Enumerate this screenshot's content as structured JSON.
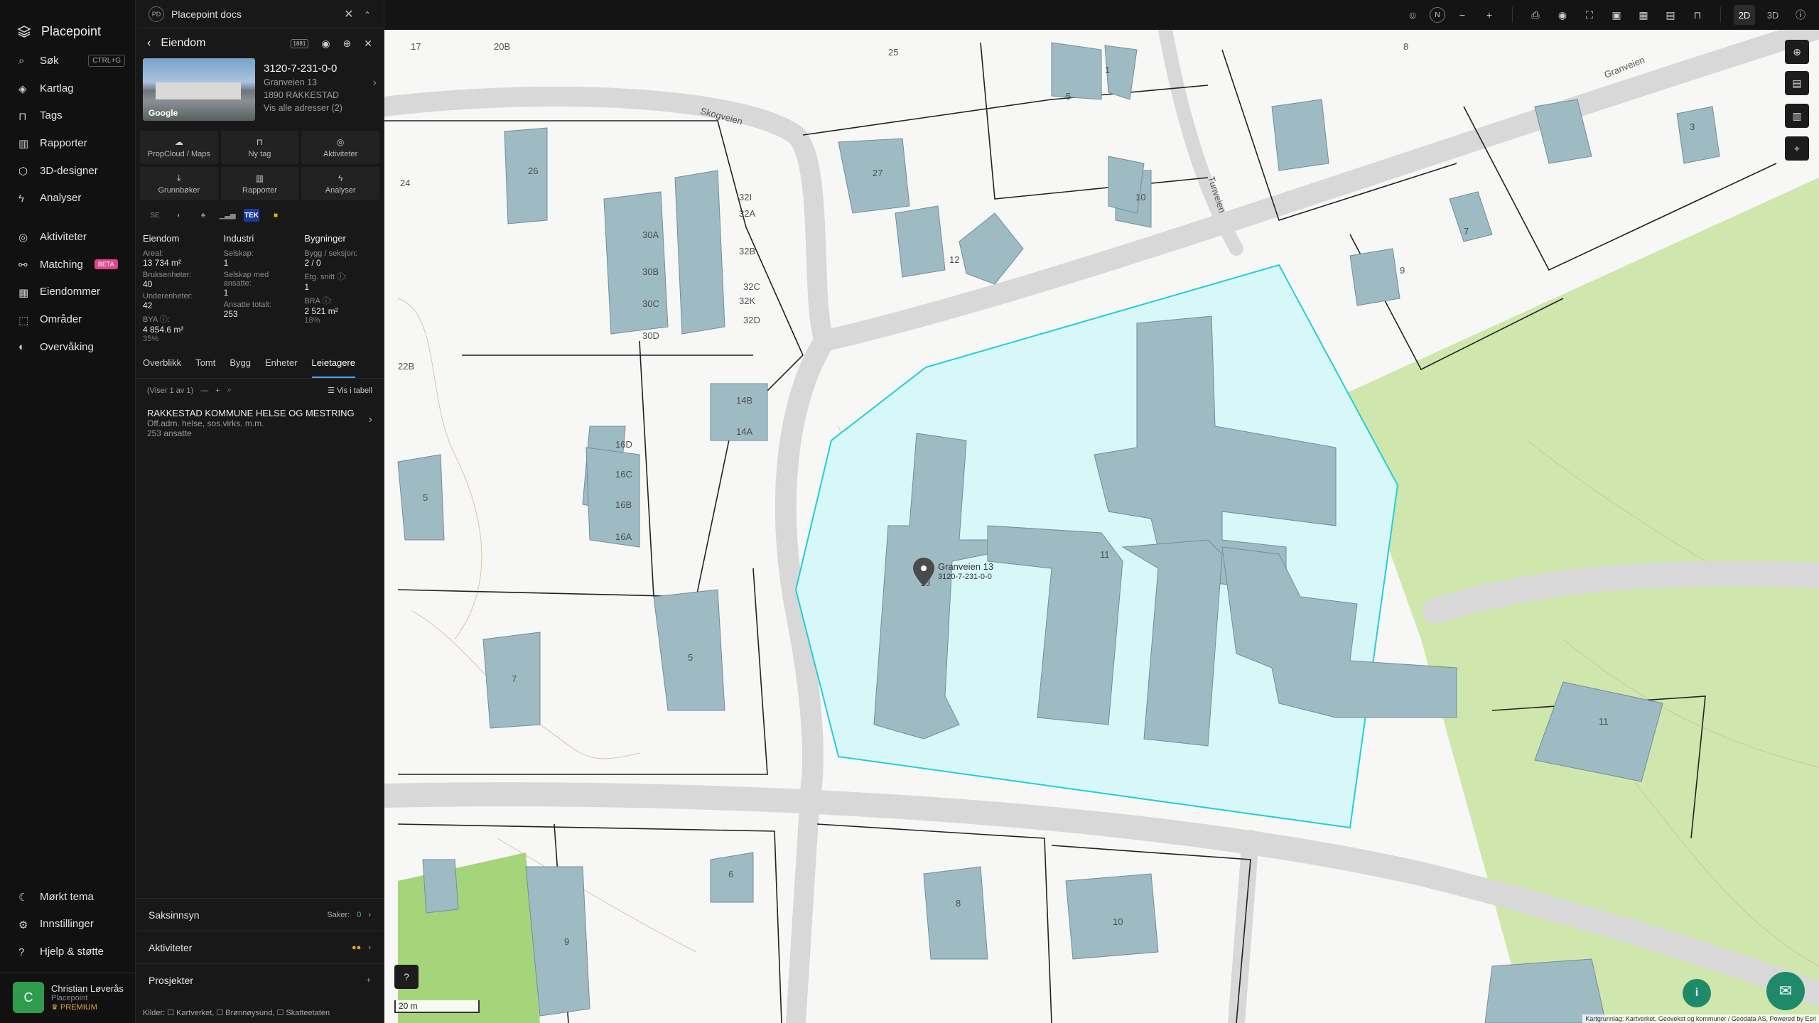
{
  "app": {
    "name": "Placepoint"
  },
  "nav": {
    "items": [
      {
        "label": "Søk",
        "icon": "search-icon",
        "kbd": "CTRL+G"
      },
      {
        "label": "Kartlag",
        "icon": "layers-icon"
      },
      {
        "label": "Tags",
        "icon": "bookmark-icon"
      },
      {
        "label": "Rapporter",
        "icon": "chart-icon"
      },
      {
        "label": "3D-designer",
        "icon": "cube-icon"
      },
      {
        "label": "Analyser",
        "icon": "bolt-icon"
      }
    ],
    "items2": [
      {
        "label": "Aktiviteter",
        "icon": "activity-icon"
      },
      {
        "label": "Matching",
        "icon": "match-icon",
        "badge": "BETA"
      },
      {
        "label": "Eiendommer",
        "icon": "building-icon"
      },
      {
        "label": "Områder",
        "icon": "area-icon"
      },
      {
        "label": "Overvåking",
        "icon": "monitor-icon"
      }
    ],
    "bottom": [
      {
        "label": "Mørkt tema",
        "icon": "moon-icon"
      },
      {
        "label": "Innstillinger",
        "icon": "gear-icon"
      },
      {
        "label": "Hjelp & støtte",
        "icon": "help-icon"
      }
    ]
  },
  "user": {
    "initial": "C",
    "name": "Christian Løverås",
    "org": "Placepoint",
    "plan": "PREMIUM"
  },
  "tab": {
    "logo": "PD",
    "title": "Placepoint docs"
  },
  "panel": {
    "title": "Eiendom",
    "badge": "1881",
    "property": {
      "id": "3120-7-231-0-0",
      "address": "Granveien 13",
      "postal": "1890 RAKKESTAD",
      "all_addresses": "Vis alle adresser (2)",
      "thumb_label": "Google"
    },
    "actions": [
      {
        "label": "PropCloud / Maps",
        "icon": "cloud-icon"
      },
      {
        "label": "Ny tag",
        "icon": "bookmark-icon"
      },
      {
        "label": "Aktiviteter",
        "icon": "activity-icon"
      },
      {
        "label": "Grunnbøker",
        "icon": "download-icon"
      },
      {
        "label": "Rapporter",
        "icon": "chart-icon"
      },
      {
        "label": "Analyser",
        "icon": "bolt-icon"
      }
    ],
    "sources": [
      "SE",
      "TEK"
    ],
    "stats": {
      "eiendom": {
        "title": "Eiendom",
        "areal_k": "Areal:",
        "areal_v": "13 734 m²",
        "bruks_k": "Bruksenheter:",
        "bruks_v": "40",
        "under_k": "Underenheter:",
        "under_v": "42",
        "bya_k": "BYA ⓘ:",
        "bya_v": "4 854.6 m²",
        "bya_s": "35%"
      },
      "industri": {
        "title": "Industri",
        "selskap_k": "Selskap:",
        "selskap_v": "1",
        "med_k": "Selskap med ansatte:",
        "med_v": "1",
        "ans_k": "Ansatte totalt:",
        "ans_v": "253"
      },
      "bygninger": {
        "title": "Bygninger",
        "bygg_k": "Bygg / seksjon:",
        "bygg_v": "2 / 0",
        "etg_k": "Etg. snitt ⓘ:",
        "etg_v": "1",
        "bra_k": "BRA ⓘ:",
        "bra_v": "2 521 m²",
        "bra_s": "18%"
      }
    },
    "subtabs": [
      "Overblikk",
      "Tomt",
      "Bygg",
      "Enheter",
      "Leietagere"
    ],
    "list": {
      "count": "(Viser 1 av 1)",
      "view": "Vis i tabell"
    },
    "tenant": {
      "name": "RAKKESTAD KOMMUNE HELSE OG MESTRING",
      "desc": "Off.adm. helse, sos.virks. m.m.",
      "emp": "253 ansatte"
    },
    "sections": {
      "saksinnsyn": "Saksinnsyn",
      "saker_label": "Saker:",
      "saker_value": "0",
      "aktiviteter": "Aktiviteter",
      "prosjekter": "Prosjekter"
    },
    "sources_footer": "Kilder:  ☐ Kartverket,  ☐ Brønnøysund,  ☐ Skatteetaten"
  },
  "toolbar": {
    "mode2d": "2D",
    "mode3d": "3D",
    "north": "N"
  },
  "map": {
    "scale": "20 m",
    "attribution": "Kartgrunnlag: Kartverket, Geovekst og kommuner / Geodata AS, Powered by Esri",
    "pin_label": "Granveien 13",
    "pin_sub": "3120-7-231-0-0",
    "roads": [
      "Skogveien",
      "Granveien",
      "Tunveien"
    ],
    "house_numbers": [
      "17",
      "20B",
      "25",
      "8",
      "1",
      "26",
      "24",
      "27",
      "10",
      "12",
      "9",
      "7",
      "5",
      "30A",
      "30B",
      "30C",
      "30D",
      "32I",
      "32A",
      "32B",
      "32C",
      "32K",
      "32D",
      "22B",
      "14B",
      "14A",
      "16D",
      "16C",
      "16B",
      "16A",
      "5",
      "7",
      "5",
      "3",
      "11",
      "13",
      "11",
      "6",
      "8",
      "10",
      "9"
    ]
  },
  "colors": {
    "accent": "#4aa6ff",
    "building": "#9ebbc4",
    "selection": "#d7f7f8",
    "outline": "#22cfd6",
    "green": "#a7d67a"
  }
}
